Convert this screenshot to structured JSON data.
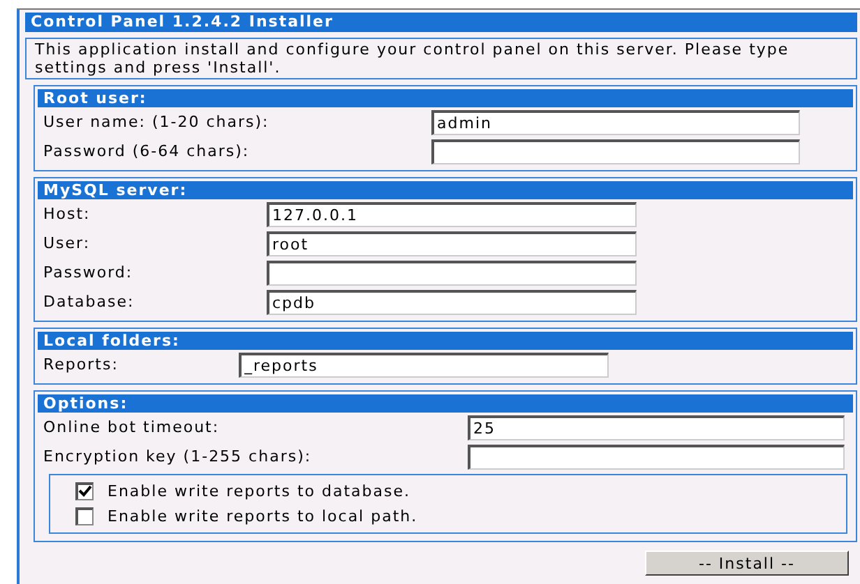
{
  "window": {
    "title": "Control Panel 1.2.4.2 Installer"
  },
  "description": "This application install and configure your control panel on this server. Please type settings and press 'Install'.",
  "sections": [
    {
      "title": "Root user:",
      "fields": [
        {
          "label": "User name: (1-20 chars):",
          "value": "admin"
        },
        {
          "label": "Password (6-64 chars):"
        }
      ]
    },
    {
      "title": "MySQL server:",
      "fields": [
        {
          "label": "Host:",
          "value": "127.0.0.1"
        },
        {
          "label": "User:",
          "value": "root"
        },
        {
          "label": "Password:"
        },
        {
          "label": "Database:",
          "value": "cpdb"
        }
      ]
    },
    {
      "title": "Local folders:",
      "fields": [
        {
          "label": "Reports:",
          "value": "_reports"
        }
      ]
    },
    {
      "title": "Options:",
      "fields": [
        {
          "label": "Online bot timeout:",
          "value": "25"
        },
        {
          "label": "Encryption key (1-255 chars):"
        }
      ],
      "checkboxes": [
        {
          "label": "Enable write reports to database.",
          "checked": true
        },
        {
          "label": "Enable write reports to local path.",
          "checked": false
        }
      ]
    }
  ],
  "buttons": [
    "-- Install --"
  ]
}
